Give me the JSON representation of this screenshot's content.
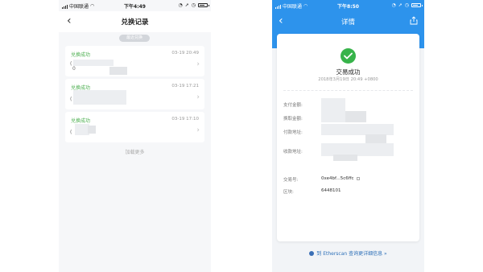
{
  "left_phone": {
    "status_bar": {
      "carrier": "中国联通",
      "time": "下午4:49"
    },
    "header": {
      "back_glyph": "‹",
      "title": "兑换记录"
    },
    "pill_label": "最近兑换",
    "records": [
      {
        "status": "兑换成功",
        "date": "03-19 20:49",
        "glyph_a": "(",
        "glyph_b": "0"
      },
      {
        "status": "兑换成功",
        "date": "03-19 17:21",
        "glyph_a": "(",
        "glyph_b": ""
      },
      {
        "status": "兑换成功",
        "date": "03-19 17:10",
        "glyph_a": "(",
        "glyph_b": ""
      }
    ],
    "chevron": "›",
    "load_more": "加载更多"
  },
  "right_phone": {
    "status_bar": {
      "carrier": "中国联通",
      "time": "下午8:50"
    },
    "header": {
      "back_glyph": "‹",
      "title": "详情",
      "share_icon": "share-icon"
    },
    "success_title": "交易成功",
    "timestamp": "2018年3月19日 20:49 +0800",
    "fields": {
      "pay_amount_label": "支付金额:",
      "exchange_amount_label": "换取金额:",
      "pay_address_label": "付款地址:",
      "receive_address_label": "收款地址:",
      "tx_hash_label": "交易号:",
      "tx_hash_value": "0xe4bf...5c6ffc",
      "block_label": "区块:",
      "block_value": "6448101"
    },
    "footer_link": "到 Etherscan 查询更详细信息 »"
  },
  "colors": {
    "accent_blue": "#2d93ec",
    "success_green": "#37b34a",
    "status_green": "#4caf50"
  }
}
